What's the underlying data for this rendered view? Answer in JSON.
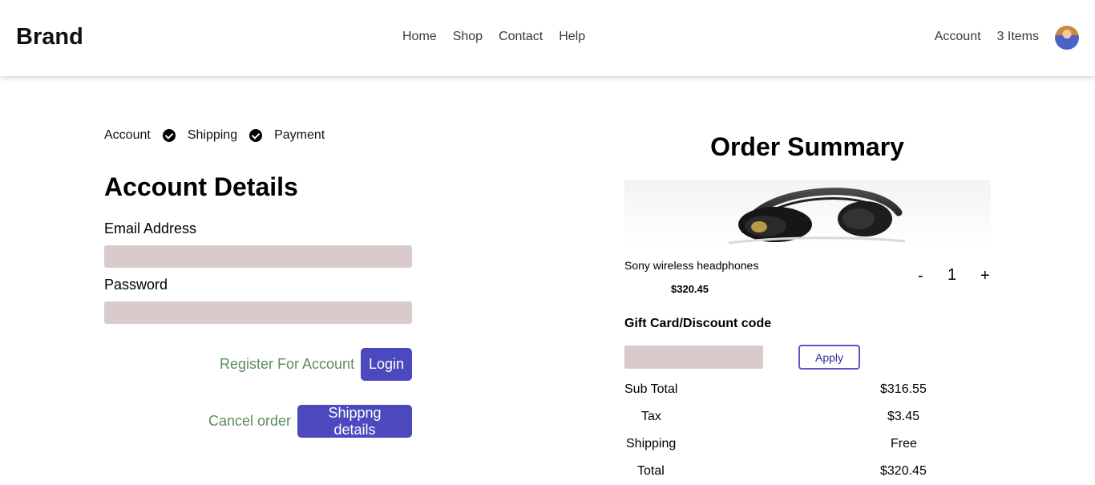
{
  "header": {
    "brand": "Brand",
    "nav": [
      "Home",
      "Shop",
      "Contact",
      "Help"
    ],
    "account": "Account",
    "cart": "3 Items"
  },
  "steps": [
    "Account",
    "Shipping",
    "Payment"
  ],
  "account_form": {
    "title": "Account Details",
    "email_label": "Email Address",
    "email_value": "",
    "password_label": "Password",
    "password_value": "",
    "register_link": "Register For Account",
    "login_button": "Login",
    "cancel_link": "Cancel order",
    "shipping_button": "Shippng details"
  },
  "summary": {
    "title": "Order Summary",
    "product_name": "Sony wireless headphones",
    "product_price": "$320.45",
    "qty_minus": "-",
    "quantity": "1",
    "qty_plus": "+",
    "gift_label": "Gift Card/Discount code",
    "gift_value": "",
    "apply_button": "Apply",
    "subtotal_label": "Sub Total",
    "subtotal_value": "$316.55",
    "tax_label": "Tax",
    "tax_value": "$3.45",
    "shipping_label": "Shipping",
    "shipping_value": "Free",
    "total_label": "Total",
    "total_value": "$320.45"
  },
  "icons": {
    "step_check": "check-circle-icon",
    "avatar": "user-avatar-icon"
  },
  "colors": {
    "accent": "#4c48bd",
    "link_green": "#5c8c5c",
    "input_bg": "#d9cbcb"
  }
}
